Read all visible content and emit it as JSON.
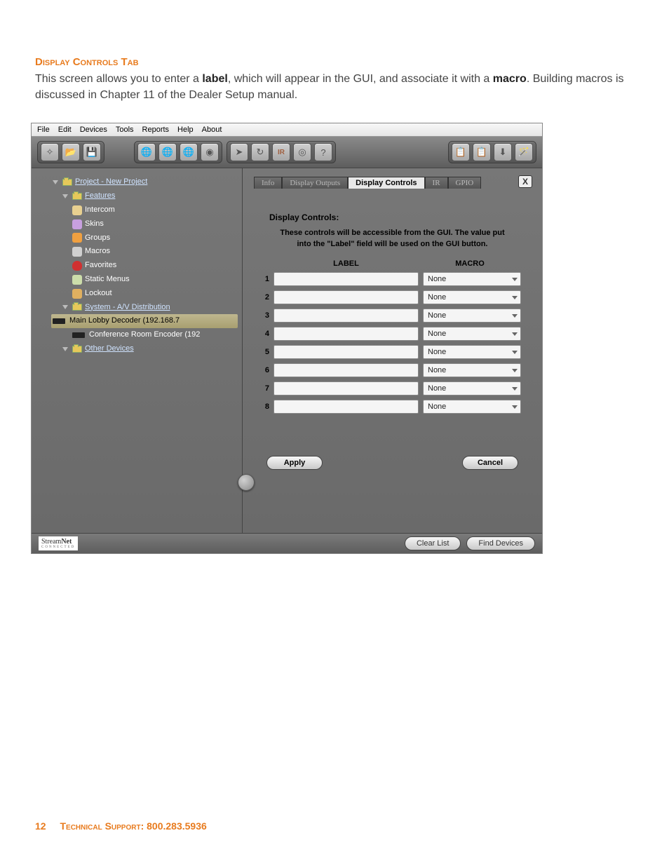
{
  "doc": {
    "section_title": "Display Controls Tab",
    "intro_1a": "This screen allows you to enter a ",
    "intro_1b": "label",
    "intro_1c": ", which will appear in the GUI, and associate it with a ",
    "intro_1d": "macro",
    "intro_1e": ". Building macros is discussed in Chapter 11 of the Dealer Setup manual."
  },
  "menu": [
    "File",
    "Edit",
    "Devices",
    "Tools",
    "Reports",
    "Help",
    "About"
  ],
  "tree": {
    "project": "Project - New Project",
    "features": "Features",
    "items": [
      "Intercom",
      "Skins",
      "Groups",
      "Macros",
      "Favorites",
      "Static Menus",
      "Lockout"
    ],
    "system": "System - A/V Distribution",
    "dev1": "Main Lobby Decoder (192.168.7",
    "dev2": "Conference Room Encoder (192",
    "other": "Other Devices"
  },
  "tabs": [
    "Info",
    "Display Outputs",
    "Display Controls",
    "IR",
    "GPIO"
  ],
  "panel": {
    "heading": "Display Controls:",
    "desc1": "These controls will be accessible from the GUI.  The value put",
    "desc2": "into the \"Label\" field will be used on the GUI button.",
    "col_label": "LABEL",
    "col_macro": "MACRO",
    "rows": [
      {
        "n": "1",
        "macro": "None"
      },
      {
        "n": "2",
        "macro": "None"
      },
      {
        "n": "3",
        "macro": "None"
      },
      {
        "n": "4",
        "macro": "None"
      },
      {
        "n": "5",
        "macro": "None"
      },
      {
        "n": "6",
        "macro": "None"
      },
      {
        "n": "7",
        "macro": "None"
      },
      {
        "n": "8",
        "macro": "None"
      }
    ],
    "apply": "Apply",
    "cancel": "Cancel"
  },
  "footer": {
    "logo1": "Stream",
    "logo2": "Net",
    "logo3": "CONNECTED",
    "clear": "Clear List",
    "find": "Find Devices"
  },
  "close_x": "X",
  "pagefoot": {
    "num": "12",
    "sup": "Technical Support: ",
    "ph": "800.283.5936"
  }
}
